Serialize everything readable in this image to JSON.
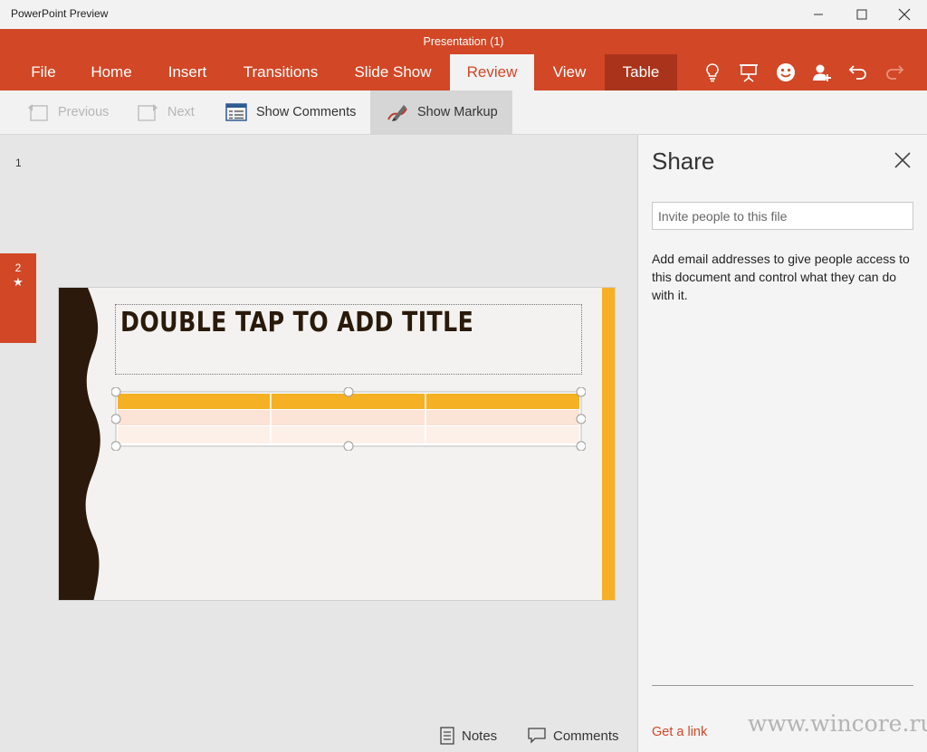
{
  "window": {
    "app_title": "PowerPoint Preview",
    "controls": [
      "minimize-icon",
      "maximize-icon",
      "close-icon"
    ]
  },
  "ribbon": {
    "document_title": "Presentation (1)",
    "tabs": [
      {
        "label": "File"
      },
      {
        "label": "Home"
      },
      {
        "label": "Insert"
      },
      {
        "label": "Transitions"
      },
      {
        "label": "Slide Show"
      },
      {
        "label": "Review",
        "active": true
      },
      {
        "label": "View"
      },
      {
        "label": "Table",
        "contextual": true
      }
    ],
    "icons": [
      "lightbulb-icon",
      "present-icon",
      "smiley-icon",
      "add-person-icon",
      "undo-icon",
      "redo-icon"
    ],
    "accent_color": "#d24726",
    "contextual_tab_color": "#a9341b"
  },
  "commands": {
    "previous": "Previous",
    "next": "Next",
    "show_comments": "Show Comments",
    "show_markup": "Show Markup"
  },
  "slides_pane": {
    "slide1_number": "1",
    "slide2_number": "2",
    "slide2_star": "★"
  },
  "slide": {
    "title_placeholder": "DOUBLE TAP TO ADD TITLE",
    "table": {
      "columns": 3,
      "rows": 3
    },
    "colors": {
      "left_band": "#2b1a0b",
      "accent_bar": "#f6b025",
      "header_row": "#f5b123",
      "row_light": "#fbe3d6"
    }
  },
  "status": {
    "notes": "Notes",
    "comments": "Comments"
  },
  "share": {
    "title": "Share",
    "invite_placeholder": "Invite people to this file",
    "description": "Add email addresses to give people access to this document and control what they can do with it.",
    "get_link": "Get a link"
  },
  "watermark": "www.wincore.ru"
}
